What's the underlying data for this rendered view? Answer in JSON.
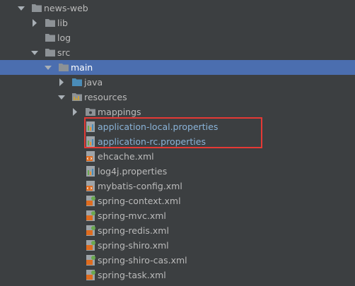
{
  "tree": [
    {
      "name": "news-web",
      "type": "folder",
      "arrow": "expanded",
      "level": 0,
      "selected": false
    },
    {
      "name": "lib",
      "type": "folder",
      "arrow": "collapsed",
      "level": 1,
      "selected": false
    },
    {
      "name": "log",
      "type": "folder",
      "arrow": "none",
      "level": 1,
      "selected": false
    },
    {
      "name": "src",
      "type": "folder",
      "arrow": "expanded",
      "level": 1,
      "selected": false
    },
    {
      "name": "main",
      "type": "folder",
      "arrow": "expanded",
      "level": 2,
      "selected": true
    },
    {
      "name": "java",
      "type": "source-folder",
      "arrow": "collapsed",
      "level": 3,
      "selected": false
    },
    {
      "name": "resources",
      "type": "resources-folder",
      "arrow": "expanded",
      "level": 3,
      "selected": false
    },
    {
      "name": "mappings",
      "type": "package-folder",
      "arrow": "collapsed",
      "level": 4,
      "selected": false
    },
    {
      "name": "application-local.properties",
      "type": "properties-file",
      "arrow": "none",
      "level": 4,
      "selected": false,
      "highlighted": true,
      "blue": true
    },
    {
      "name": "application-rc.properties",
      "type": "properties-file",
      "arrow": "none",
      "level": 4,
      "selected": false,
      "highlighted": true,
      "blue": true
    },
    {
      "name": "ehcache.xml",
      "type": "xml-file",
      "arrow": "none",
      "level": 4,
      "selected": false
    },
    {
      "name": "log4j.properties",
      "type": "properties-file",
      "arrow": "none",
      "level": 4,
      "selected": false
    },
    {
      "name": "mybatis-config.xml",
      "type": "xml-file",
      "arrow": "none",
      "level": 4,
      "selected": false
    },
    {
      "name": "spring-context.xml",
      "type": "spring-xml-file",
      "arrow": "none",
      "level": 4,
      "selected": false
    },
    {
      "name": "spring-mvc.xml",
      "type": "spring-xml-file",
      "arrow": "none",
      "level": 4,
      "selected": false
    },
    {
      "name": "spring-redis.xml",
      "type": "spring-xml-file",
      "arrow": "none",
      "level": 4,
      "selected": false
    },
    {
      "name": "spring-shiro.xml",
      "type": "spring-xml-file",
      "arrow": "none",
      "level": 4,
      "selected": false
    },
    {
      "name": "spring-shiro-cas.xml",
      "type": "spring-xml-file",
      "arrow": "none",
      "level": 4,
      "selected": false
    },
    {
      "name": "spring-task.xml",
      "type": "spring-xml-file",
      "arrow": "none",
      "level": 4,
      "selected": false
    }
  ],
  "colors": {
    "background": "#3c3f41",
    "selection": "#4b6eaf",
    "text": "#bbbbbb",
    "highlighted_text": "#8ab3d8",
    "highlight_border": "#e53935",
    "folder": "#8d9296",
    "source_folder": "#4a8cb8"
  }
}
